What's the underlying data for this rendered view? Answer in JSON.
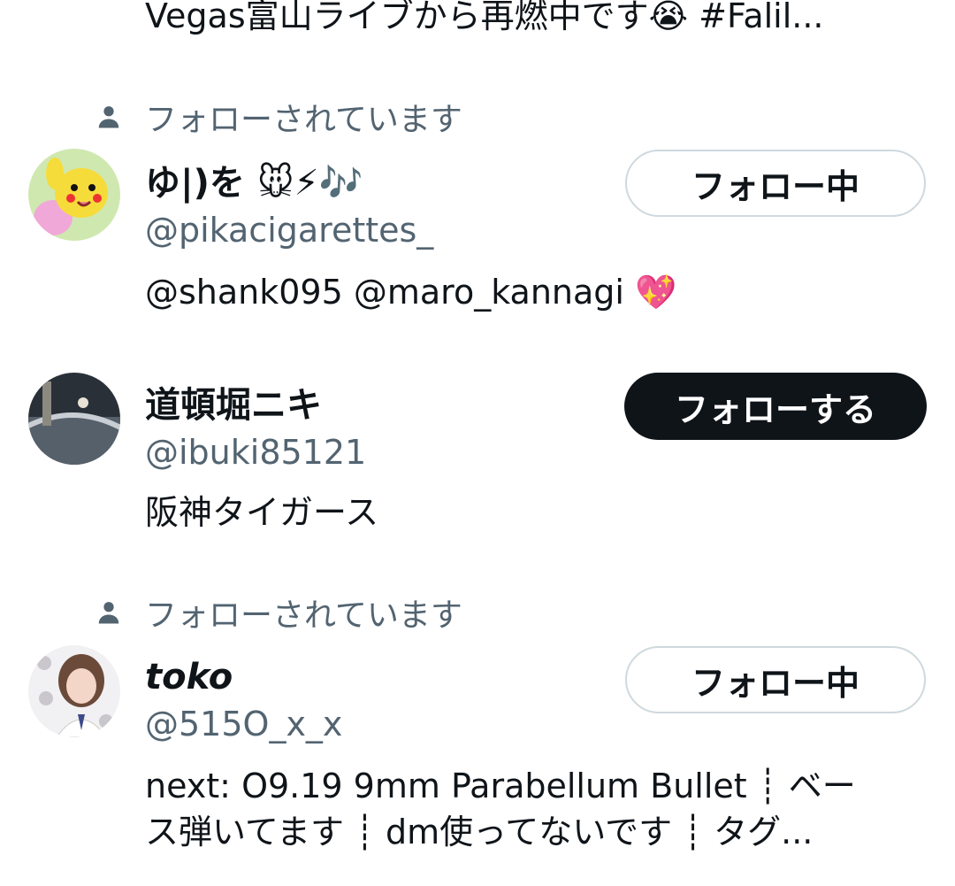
{
  "previous_bio": "Vegas富山ライブから再燃中です😭 #Falil...",
  "users": [
    {
      "context": "フォローされています",
      "name": "ゆ|)を 🐭⚡🎶",
      "handle": "@pikacigarettes_",
      "bio": "@shank095 @maro_kannagi 💖",
      "button": "フォロー中",
      "button_style": "outline"
    },
    {
      "name": "道頓堀ニキ",
      "handle": "@ibuki85121",
      "bio": "阪神タイガース",
      "button": "フォローする",
      "button_style": "solid"
    },
    {
      "context": "フォローされています",
      "name": "toko",
      "handle": "@515O_x_x",
      "bio_line1": "next: O9.19 9mm Parabellum Bullet ┊ ベー",
      "bio_line2": "ス弾いてます ┊ dm使ってないです ┊ タグ...",
      "button": "フォロー中",
      "button_style": "outline"
    }
  ],
  "colors": {
    "text": "#0f1419",
    "muted": "#536471",
    "button_border": "#cfd9de",
    "button_solid_bg": "#0f1419"
  },
  "icons": [
    "person-icon"
  ]
}
